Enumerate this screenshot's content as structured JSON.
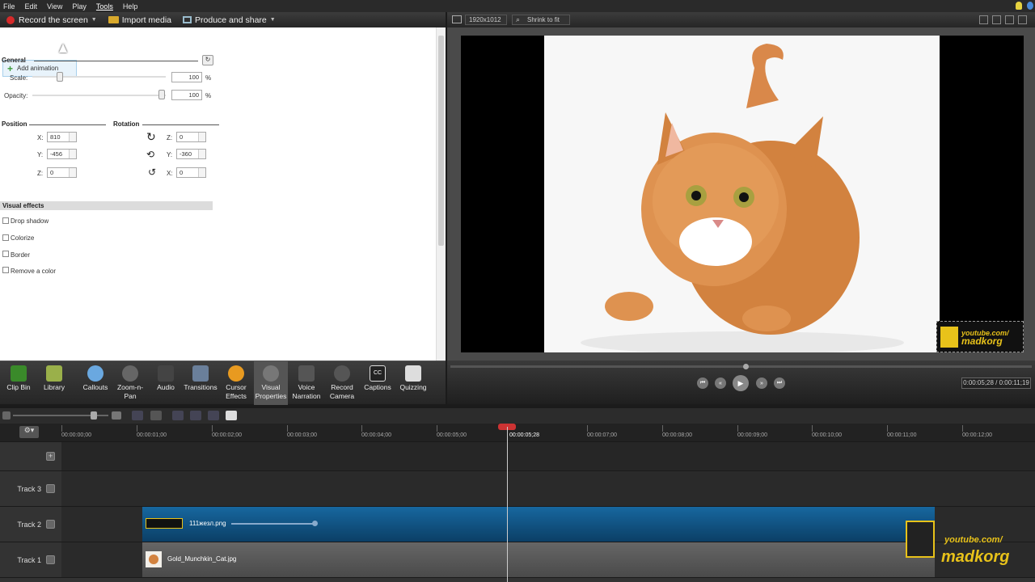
{
  "menu": [
    "File",
    "Edit",
    "View",
    "Play",
    "Tools",
    "Help"
  ],
  "toolbar": {
    "record": "Record the screen",
    "import": "Import media",
    "produce": "Produce and share"
  },
  "props": {
    "add_animation": "Add animation",
    "general": "General",
    "scale_label": "Scale:",
    "scale_value": "100",
    "scale_unit": "%",
    "opacity_label": "Opacity:",
    "opacity_value": "100",
    "opacity_unit": "%",
    "position": "Position",
    "rotation": "Rotation",
    "pos_x_label": "X:",
    "pos_x": "810",
    "pos_y_label": "Y:",
    "pos_y": "-456",
    "pos_z_label": "Z:",
    "pos_z": "0",
    "rot_z_label": "Z:",
    "rot_z": "0",
    "rot_y_label": "Y:",
    "rot_y": "-360",
    "rot_x_label": "X:",
    "rot_x": "0",
    "visual_effects": "Visual effects",
    "effects": [
      "Drop shadow",
      "Colorize",
      "Border",
      "Remove a color"
    ]
  },
  "tasks": [
    {
      "l1": "Clip Bin",
      "l2": "",
      "color": "#3a8a2a"
    },
    {
      "l1": "Library",
      "l2": "",
      "color": "#9ab04a"
    },
    {
      "l1": "Callouts",
      "l2": "",
      "color": "#6aa8e0"
    },
    {
      "l1": "Zoom-n-",
      "l2": "Pan",
      "color": "#666"
    },
    {
      "l1": "Audio",
      "l2": "",
      "color": "#444"
    },
    {
      "l1": "Transitions",
      "l2": "",
      "color": "#6a7f9a"
    },
    {
      "l1": "Cursor",
      "l2": "Effects",
      "color": "#e89a20"
    },
    {
      "l1": "Visual",
      "l2": "Properties",
      "color": "#777"
    },
    {
      "l1": "Voice",
      "l2": "Narration",
      "color": "#555"
    },
    {
      "l1": "Record",
      "l2": "Camera",
      "color": "#555"
    },
    {
      "l1": "Captions",
      "l2": "",
      "color": "#222"
    },
    {
      "l1": "Quizzing",
      "l2": "",
      "color": "#ddd"
    }
  ],
  "canvas": {
    "dimension": "1920x1012",
    "zoom": "Shrink to fit"
  },
  "logo": {
    "line1": "youtube.com/",
    "line2": "madkorg"
  },
  "playback": {
    "time": "0:00:05;28 / 0:00:11;19"
  },
  "timeline": {
    "ticks": [
      "00:00:00;00",
      "00:00:01;00",
      "00:00:02;00",
      "00:00:03;00",
      "00:00:04;00",
      "00:00:05;00",
      "00:00:05;28",
      "00:00:07;00",
      "00:00:08;00",
      "00:00:09;00",
      "00:00:10;00",
      "00:00:11;00",
      "00:00:12;00"
    ],
    "tracks": [
      "Track 3",
      "Track 2",
      "Track 1"
    ],
    "clip2": "111жезл.png",
    "clip1": "Gold_Munchkin_Cat.jpg"
  },
  "colors": {
    "clip2": "#0e4c7a",
    "clip1": "#5a5a5a",
    "playhead": "#c33"
  }
}
